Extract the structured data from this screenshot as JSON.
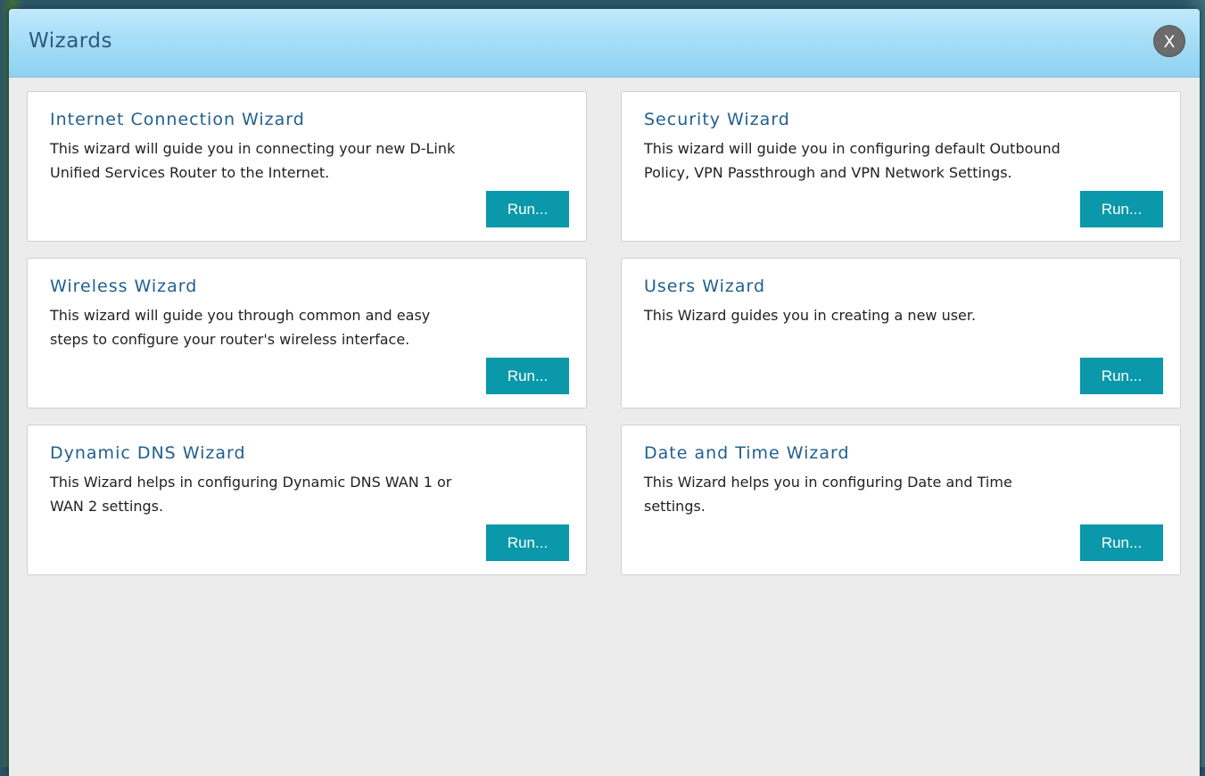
{
  "dialog": {
    "title": "Wizards",
    "close_label": "X"
  },
  "wizards": [
    {
      "title": "Internet Connection Wizard",
      "description": "This wizard will guide you in connecting your new D-Link Unified Services Router to the Internet.",
      "button_label": "Run..."
    },
    {
      "title": "Security Wizard",
      "description": "This wizard will guide you in configuring default Outbound Policy, VPN Passthrough and VPN Network Settings.",
      "button_label": "Run..."
    },
    {
      "title": "Wireless Wizard",
      "description": "This wizard will guide you through common and easy steps to configure your router's wireless interface.",
      "button_label": "Run..."
    },
    {
      "title": "Users Wizard",
      "description": "This Wizard guides you in creating a new user.",
      "button_label": "Run..."
    },
    {
      "title": "Dynamic DNS Wizard",
      "description": "This Wizard helps in configuring Dynamic DNS WAN 1 or WAN 2 settings.",
      "button_label": "Run..."
    },
    {
      "title": "Date and Time Wizard",
      "description": "This Wizard helps you in configuring Date and Time settings.",
      "button_label": "Run..."
    }
  ],
  "colors": {
    "header_gradient_top": "#bfe9fb",
    "header_gradient_bottom": "#8fd1f1",
    "title_text": "#2e5a78",
    "card_title": "#22608e",
    "button_bg": "#0a98aa",
    "panel_bg": "#ececec"
  }
}
